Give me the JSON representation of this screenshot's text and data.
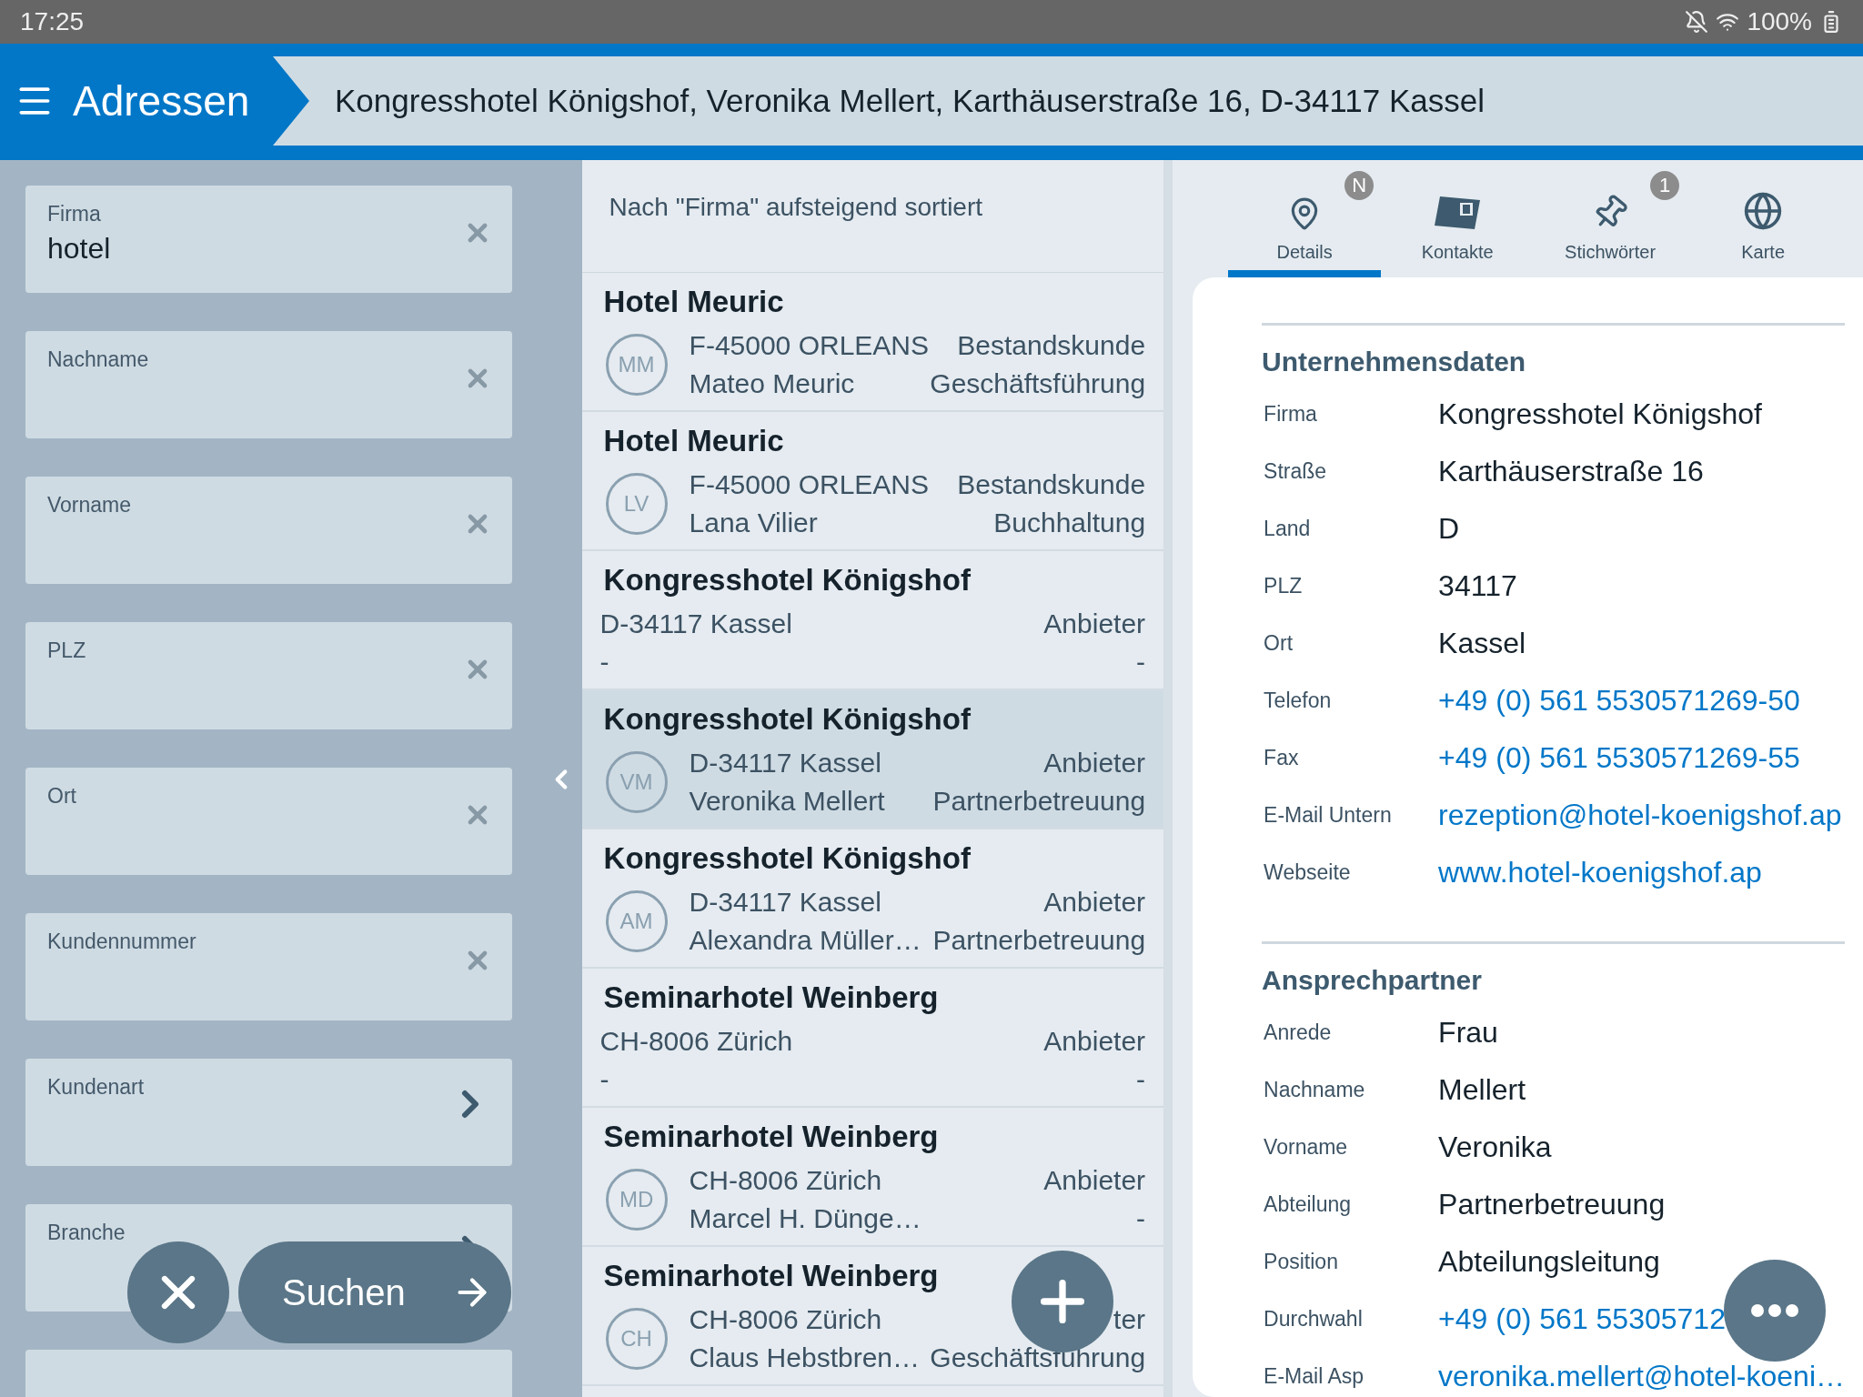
{
  "status_bar": {
    "time": "17:25",
    "battery": "100%"
  },
  "header": {
    "title": "Adressen",
    "breadcrumb": "Kongresshotel Königshof, Veronika Mellert, Karthäuserstraße 16, D-34117 Kassel"
  },
  "filters": [
    {
      "kind": "text",
      "label": "Firma",
      "value": "hotel"
    },
    {
      "kind": "text",
      "label": "Nachname"
    },
    {
      "kind": "text",
      "label": "Vorname"
    },
    {
      "kind": "text",
      "label": "PLZ"
    },
    {
      "kind": "text",
      "label": "Ort"
    },
    {
      "kind": "text",
      "label": "Kundennummer"
    },
    {
      "kind": "select",
      "label": "Kundenart"
    },
    {
      "kind": "select",
      "label": "Branche"
    },
    {
      "kind": "hidden"
    }
  ],
  "filter_actions": {
    "search": "Suchen"
  },
  "list": {
    "sort_info": "Nach \"Firma\" aufsteigend sortiert",
    "rows": [
      {
        "kind": "contact",
        "title": "Hotel Meuric",
        "initials": "MM",
        "line1": "F-45000 ORLEANS",
        "line2": "Mateo Meuric",
        "right1": "Bestandskunde",
        "right2": "Geschäftsführung",
        "selected": false
      },
      {
        "kind": "contact",
        "title": "Hotel Meuric",
        "initials": "LV",
        "line1": "F-45000 ORLEANS",
        "line2": "Lana  Vilier",
        "right1": "Bestandskunde",
        "right2": "Buchhaltung",
        "selected": false
      },
      {
        "kind": "company",
        "title": "Kongresshotel Königshof",
        "line1": "D-34117 Kassel",
        "line2": "-",
        "right1": "Anbieter",
        "right2": "-",
        "selected": false
      },
      {
        "kind": "contact",
        "title": "Kongresshotel Königshof",
        "initials": "VM",
        "line1": "D-34117 Kassel",
        "line2": "Veronika Mellert",
        "right1": "Anbieter",
        "right2": "Partnerbetreuung",
        "selected": true
      },
      {
        "kind": "contact",
        "title": "Kongresshotel Königshof",
        "initials": "AM",
        "line1": "D-34117 Kassel",
        "line2": "Alexandra Müller…",
        "right1": "Anbieter",
        "right2": "Partnerbetreuung",
        "selected": false
      },
      {
        "kind": "company",
        "title": "Seminarhotel Weinberg",
        "line1": "CH-8006 Zürich",
        "line2": "-",
        "right1": "Anbieter",
        "right2": "-",
        "selected": false
      },
      {
        "kind": "contact",
        "title": "Seminarhotel Weinberg",
        "initials": "MD",
        "line1": "CH-8006 Zürich",
        "line2": "Marcel H. Dünge…",
        "right1": "Anbieter",
        "right2": "-",
        "selected": false
      },
      {
        "kind": "contact",
        "title": "Seminarhotel Weinberg",
        "initials": "CH",
        "line1": "CH-8006 Zürich",
        "line2": "Claus Hebstbren…",
        "right1": "ter",
        "right2": "Geschäftsführung",
        "selected": false
      }
    ]
  },
  "tabs": [
    {
      "kind": "pin",
      "label": "Details",
      "badge": "N",
      "selected": true
    },
    {
      "kind": "card",
      "label": "Kontakte",
      "selected": false
    },
    {
      "kind": "pushpin",
      "label": "Stichwörter",
      "badge": "1",
      "selected": false
    },
    {
      "kind": "globe",
      "label": "Karte",
      "selected": false
    }
  ],
  "details": [
    {
      "heading": "Unternehmensdaten",
      "fields": [
        {
          "label": "Firma",
          "value": "Kongresshotel Königshof",
          "kind": "text"
        },
        {
          "label": "Straße",
          "value": "Karthäuserstraße 16",
          "kind": "text"
        },
        {
          "label": "Land",
          "value": "D",
          "kind": "text"
        },
        {
          "label": "PLZ",
          "value": "34117",
          "kind": "text"
        },
        {
          "label": "Ort",
          "value": "Kassel",
          "kind": "text"
        },
        {
          "label": "Telefon",
          "value": "+49 (0) 561 5530571269-50",
          "kind": "link"
        },
        {
          "label": "Fax",
          "value": "+49 (0) 561 5530571269-55",
          "kind": "link"
        },
        {
          "label": "E-Mail Untern",
          "value": "rezeption@hotel-koenigshof.ap",
          "kind": "link"
        },
        {
          "label": "Webseite",
          "value": "www.hotel-koenigshof.ap",
          "kind": "link"
        }
      ]
    },
    {
      "heading": "Ansprechpartner",
      "fields": [
        {
          "label": "Anrede",
          "value": "Frau",
          "kind": "text"
        },
        {
          "label": "Nachname",
          "value": "Mellert",
          "kind": "text"
        },
        {
          "label": "Vorname",
          "value": "Veronika",
          "kind": "text"
        },
        {
          "label": "Abteilung",
          "value": "Partnerbetreuung",
          "kind": "text"
        },
        {
          "label": "Position",
          "value": "Abteilungsleitung",
          "kind": "text"
        },
        {
          "label": "Durchwahl",
          "value": "+49 (0) 561 55305712",
          "kind": "link"
        },
        {
          "label": "E-Mail Asp",
          "value": "veronika.mellert@hotel-koeni…",
          "kind": "link"
        }
      ]
    }
  ]
}
